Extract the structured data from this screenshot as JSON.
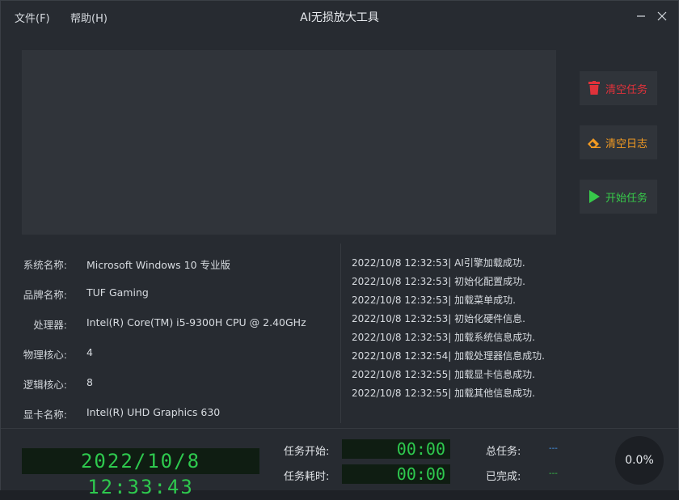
{
  "menu": {
    "file": "文件(F)",
    "help": "帮助(H)"
  },
  "app_title": "AI无损放大工具",
  "actions": {
    "clear_tasks": {
      "label": "清空任务",
      "color": "#e0323a"
    },
    "clear_log": {
      "label": "清空日志",
      "color": "#f29a22"
    },
    "start_task": {
      "label": "开始任务",
      "color": "#37c94a"
    }
  },
  "system_info": [
    {
      "key": "系统名称:",
      "value": "Microsoft Windows 10 专业版"
    },
    {
      "key": "品牌名称:",
      "value": "TUF Gaming"
    },
    {
      "key": "处理器:",
      "value": "Intel(R) Core(TM) i5-9300H CPU @ 2.40GHz"
    },
    {
      "key": "物理核心:",
      "value": "4"
    },
    {
      "key": "逻辑核心:",
      "value": "8"
    },
    {
      "key": "显卡名称:",
      "value": "Intel(R) UHD Graphics 630"
    }
  ],
  "log": [
    "2022/10/8 12:32:53| AI引擎加载成功.",
    "2022/10/8 12:32:53| 初始化配置成功.",
    "2022/10/8 12:32:53| 加载菜单成功.",
    "2022/10/8 12:32:53| 初始化硬件信息.",
    "2022/10/8 12:32:53| 加载系统信息成功.",
    "2022/10/8 12:32:54| 加载处理器信息成功.",
    "2022/10/8 12:32:55| 加载显卡信息成功.",
    "2022/10/8 12:32:55| 加载其他信息成功."
  ],
  "status": {
    "clock": "2022/10/8 12:33:43",
    "task_start_label": "任务开始:",
    "task_start_value": "00:00",
    "task_elapsed_label": "任务耗时:",
    "task_elapsed_value": "00:00",
    "total_tasks_label": "总任务:",
    "total_tasks_value": "---",
    "completed_label": "已完成:",
    "completed_value": "---",
    "progress_text": "0.0%",
    "progress_fraction": 0.0
  },
  "icons": {
    "minimize": "minimize-icon",
    "close": "close-icon",
    "trash": "trash-icon",
    "eraser": "eraser-icon",
    "play": "play-icon"
  }
}
